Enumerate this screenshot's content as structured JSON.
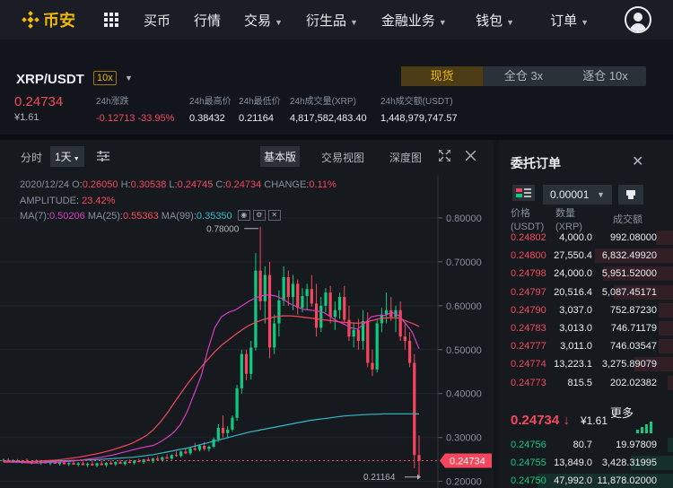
{
  "brand": {
    "name": "币安",
    "color": "#f0b90b"
  },
  "nav": {
    "items": [
      {
        "label": "买币",
        "has_dropdown": false
      },
      {
        "label": "行情",
        "has_dropdown": false
      },
      {
        "label": "交易",
        "has_dropdown": true
      },
      {
        "label": "衍生品",
        "has_dropdown": true
      },
      {
        "label": "金融业务",
        "has_dropdown": true
      }
    ],
    "right": [
      {
        "label": "钱包",
        "has_dropdown": true
      },
      {
        "label": "订单",
        "has_dropdown": true
      }
    ]
  },
  "ticker": {
    "pair": "XRP/USDT",
    "leverage": "10x",
    "last_price": "0.24734",
    "last_price_cny": "¥1.61",
    "stats": [
      {
        "label": "24h涨跌",
        "value": "-0.12713 -33.95%",
        "negative": true
      },
      {
        "label": "24h最高价",
        "value": "0.38432",
        "negative": false
      },
      {
        "label": "24h最低价",
        "value": "0.21164",
        "negative": false
      },
      {
        "label": "24h成交量(XRP)",
        "value": "4,817,582,483.40",
        "negative": false
      },
      {
        "label": "24h成交额(USDT)",
        "value": "1,448,979,747.57",
        "negative": false
      }
    ],
    "modes": [
      {
        "label": "现货",
        "active": true
      },
      {
        "label": "全仓 3x",
        "active": false
      },
      {
        "label": "逐仓 10x",
        "active": false
      }
    ]
  },
  "chart_toolbar": {
    "time_label": "分时",
    "interval": "1天",
    "views": [
      "基本版",
      "交易视图",
      "深度图"
    ],
    "active_view": "基本版"
  },
  "chart_info": {
    "date": "2020/12/24",
    "open_label": "O:",
    "open": "0.26050",
    "high_label": "H:",
    "high": "0.30538",
    "low_label": "L:",
    "low": "0.24745",
    "close_label": "C:",
    "close": "0.24734",
    "change_label": "CHANGE:",
    "change": "0.11%",
    "amplitude_label": "AMPLITUDE:",
    "amplitude": "23.42%",
    "ma7_label": "MA(7):",
    "ma7": "0.50206",
    "ma25_label": "MA(25):",
    "ma25": "0.55363",
    "ma99_label": "MA(99):",
    "ma99": "0.35350"
  },
  "chart_data": {
    "type": "candlestick",
    "y_ticks": [
      "0.80000",
      "0.70000",
      "0.60000",
      "0.50000",
      "0.40000",
      "0.30000",
      "0.20000"
    ],
    "ylim": [
      0.185,
      0.855
    ],
    "current_price_label": "0.24734",
    "annotations": {
      "high": "0.78000",
      "low": "0.21164"
    },
    "colors": {
      "up": "#0ecb81",
      "down": "#f6465d",
      "ma7": "#d63cc2",
      "ma25": "#f6465d",
      "ma99": "#31b9cc"
    },
    "candles": [
      [
        0.247,
        0.252,
        0.244,
        0.249
      ],
      [
        0.249,
        0.253,
        0.246,
        0.245
      ],
      [
        0.245,
        0.25,
        0.242,
        0.248
      ],
      [
        0.248,
        0.251,
        0.245,
        0.244
      ],
      [
        0.244,
        0.249,
        0.24,
        0.247
      ],
      [
        0.247,
        0.252,
        0.244,
        0.243
      ],
      [
        0.243,
        0.248,
        0.239,
        0.246
      ],
      [
        0.246,
        0.25,
        0.243,
        0.242
      ],
      [
        0.242,
        0.247,
        0.238,
        0.245
      ],
      [
        0.245,
        0.249,
        0.241,
        0.241
      ],
      [
        0.241,
        0.246,
        0.237,
        0.244
      ],
      [
        0.244,
        0.248,
        0.24,
        0.24
      ],
      [
        0.24,
        0.245,
        0.236,
        0.243
      ],
      [
        0.243,
        0.247,
        0.239,
        0.239
      ],
      [
        0.239,
        0.244,
        0.235,
        0.242
      ],
      [
        0.242,
        0.246,
        0.238,
        0.238
      ],
      [
        0.238,
        0.244,
        0.234,
        0.241
      ],
      [
        0.241,
        0.245,
        0.237,
        0.237
      ],
      [
        0.237,
        0.243,
        0.233,
        0.24
      ],
      [
        0.24,
        0.246,
        0.236,
        0.236
      ],
      [
        0.236,
        0.243,
        0.232,
        0.241
      ],
      [
        0.241,
        0.247,
        0.237,
        0.237
      ],
      [
        0.237,
        0.244,
        0.233,
        0.242
      ],
      [
        0.242,
        0.248,
        0.238,
        0.239
      ],
      [
        0.239,
        0.246,
        0.235,
        0.244
      ],
      [
        0.244,
        0.249,
        0.24,
        0.24
      ],
      [
        0.24,
        0.247,
        0.236,
        0.245
      ],
      [
        0.245,
        0.25,
        0.241,
        0.242
      ],
      [
        0.242,
        0.249,
        0.238,
        0.247
      ],
      [
        0.247,
        0.252,
        0.243,
        0.244
      ],
      [
        0.244,
        0.251,
        0.24,
        0.25
      ],
      [
        0.25,
        0.255,
        0.246,
        0.246
      ],
      [
        0.246,
        0.254,
        0.242,
        0.252
      ],
      [
        0.252,
        0.258,
        0.248,
        0.249
      ],
      [
        0.249,
        0.257,
        0.245,
        0.255
      ],
      [
        0.255,
        0.262,
        0.251,
        0.252
      ],
      [
        0.252,
        0.262,
        0.249,
        0.26
      ],
      [
        0.26,
        0.268,
        0.256,
        0.258
      ],
      [
        0.258,
        0.27,
        0.255,
        0.268
      ],
      [
        0.268,
        0.274,
        0.262,
        0.264
      ],
      [
        0.264,
        0.278,
        0.26,
        0.275
      ],
      [
        0.275,
        0.288,
        0.27,
        0.272
      ],
      [
        0.272,
        0.283,
        0.268,
        0.281
      ],
      [
        0.281,
        0.29,
        0.27,
        0.274
      ],
      [
        0.274,
        0.282,
        0.268,
        0.279
      ],
      [
        0.279,
        0.3,
        0.276,
        0.296
      ],
      [
        0.296,
        0.33,
        0.29,
        0.322
      ],
      [
        0.322,
        0.35,
        0.3,
        0.31
      ],
      [
        0.31,
        0.326,
        0.298,
        0.318
      ],
      [
        0.318,
        0.35,
        0.314,
        0.345
      ],
      [
        0.345,
        0.42,
        0.338,
        0.412
      ],
      [
        0.412,
        0.5,
        0.4,
        0.49
      ],
      [
        0.49,
        0.5,
        0.43,
        0.445
      ],
      [
        0.445,
        0.52,
        0.432,
        0.505
      ],
      [
        0.505,
        0.72,
        0.498,
        0.68
      ],
      [
        0.68,
        0.78,
        0.59,
        0.61
      ],
      [
        0.61,
        0.69,
        0.56,
        0.67
      ],
      [
        0.67,
        0.7,
        0.48,
        0.505
      ],
      [
        0.505,
        0.58,
        0.49,
        0.56
      ],
      [
        0.56,
        0.635,
        0.53,
        0.612
      ],
      [
        0.612,
        0.69,
        0.6,
        0.665
      ],
      [
        0.665,
        0.68,
        0.6,
        0.62
      ],
      [
        0.62,
        0.67,
        0.59,
        0.65
      ],
      [
        0.65,
        0.66,
        0.58,
        0.595
      ],
      [
        0.595,
        0.64,
        0.585,
        0.622
      ],
      [
        0.622,
        0.65,
        0.59,
        0.638
      ],
      [
        0.638,
        0.67,
        0.598,
        0.605
      ],
      [
        0.605,
        0.65,
        0.53,
        0.55
      ],
      [
        0.55,
        0.62,
        0.54,
        0.6
      ],
      [
        0.6,
        0.64,
        0.585,
        0.63
      ],
      [
        0.63,
        0.645,
        0.56,
        0.575
      ],
      [
        0.575,
        0.61,
        0.545,
        0.59
      ],
      [
        0.59,
        0.63,
        0.57,
        0.62
      ],
      [
        0.62,
        0.645,
        0.56,
        0.568
      ],
      [
        0.568,
        0.6,
        0.52,
        0.53
      ],
      [
        0.53,
        0.56,
        0.505,
        0.545
      ],
      [
        0.545,
        0.57,
        0.5,
        0.52
      ],
      [
        0.52,
        0.59,
        0.5,
        0.565
      ],
      [
        0.565,
        0.585,
        0.46,
        0.47
      ],
      [
        0.47,
        0.5,
        0.44,
        0.455
      ],
      [
        0.455,
        0.57,
        0.448,
        0.56
      ],
      [
        0.56,
        0.595,
        0.54,
        0.58
      ],
      [
        0.58,
        0.63,
        0.56,
        0.59
      ],
      [
        0.59,
        0.62,
        0.565,
        0.575
      ],
      [
        0.575,
        0.6,
        0.54,
        0.59
      ],
      [
        0.59,
        0.61,
        0.52,
        0.53
      ],
      [
        0.53,
        0.56,
        0.5,
        0.52
      ],
      [
        0.52,
        0.54,
        0.46,
        0.47
      ],
      [
        0.47,
        0.49,
        0.23,
        0.26
      ],
      [
        0.26,
        0.305,
        0.212,
        0.247
      ]
    ],
    "ma7": [
      0.246,
      0.245,
      0.244,
      0.243,
      0.242,
      0.242,
      0.243,
      0.244,
      0.244,
      0.245,
      0.246,
      0.248,
      0.25,
      0.252,
      0.254,
      0.257,
      0.26,
      0.264,
      0.268,
      0.272,
      0.276,
      0.279,
      0.282,
      0.29,
      0.3,
      0.312,
      0.33,
      0.36,
      0.4,
      0.44,
      0.5,
      0.55,
      0.575,
      0.585,
      0.59,
      0.6,
      0.61,
      0.618,
      0.623,
      0.625,
      0.622,
      0.615,
      0.605,
      0.598,
      0.592,
      0.59,
      0.588,
      0.585,
      0.575,
      0.565,
      0.558,
      0.55,
      0.547,
      0.56,
      0.575,
      0.578,
      0.578,
      0.585,
      0.578,
      0.56,
      0.54,
      0.502
    ],
    "ma25": [
      0.244,
      0.244,
      0.244,
      0.245,
      0.245,
      0.246,
      0.247,
      0.248,
      0.249,
      0.251,
      0.253,
      0.255,
      0.258,
      0.261,
      0.264,
      0.268,
      0.272,
      0.277,
      0.282,
      0.288,
      0.296,
      0.305,
      0.318,
      0.335,
      0.355,
      0.378,
      0.4,
      0.422,
      0.442,
      0.46,
      0.478,
      0.495,
      0.51,
      0.522,
      0.534,
      0.545,
      0.555,
      0.562,
      0.568,
      0.572,
      0.575,
      0.577,
      0.577,
      0.576,
      0.574,
      0.572,
      0.57,
      0.568,
      0.566,
      0.564,
      0.562,
      0.561,
      0.56,
      0.562,
      0.566,
      0.57,
      0.572,
      0.573,
      0.572,
      0.566,
      0.56,
      0.553
    ],
    "ma99": [
      0.245,
      0.245,
      0.245,
      0.245,
      0.245,
      0.246,
      0.246,
      0.246,
      0.247,
      0.247,
      0.248,
      0.248,
      0.249,
      0.249,
      0.25,
      0.251,
      0.252,
      0.253,
      0.254,
      0.255,
      0.257,
      0.259,
      0.261,
      0.264,
      0.267,
      0.27,
      0.273,
      0.276,
      0.28,
      0.284,
      0.288,
      0.292,
      0.296,
      0.3,
      0.304,
      0.308,
      0.312,
      0.315,
      0.318,
      0.321,
      0.324,
      0.327,
      0.33,
      0.333,
      0.336,
      0.339,
      0.341,
      0.343,
      0.345,
      0.347,
      0.349,
      0.35,
      0.351,
      0.352,
      0.353,
      0.353,
      0.354,
      0.354,
      0.354,
      0.354,
      0.354,
      0.3535
    ]
  },
  "order_book": {
    "title": "委托订单",
    "precision": "0.00001",
    "headers": [
      {
        "line1": "价格",
        "line2": "(USDT)"
      },
      {
        "line1": "数量",
        "line2": "(XRP)"
      },
      {
        "line1": "成交额",
        "line2": ""
      }
    ],
    "asks": [
      {
        "price": "0.24802",
        "amount": "4,000.0",
        "total": "992.08000",
        "depth": 0.1
      },
      {
        "price": "0.24800",
        "amount": "27,550.4",
        "total": "6,832.49920",
        "depth": 0.45
      },
      {
        "price": "0.24798",
        "amount": "24,000.0",
        "total": "5,951.52000",
        "depth": 0.4
      },
      {
        "price": "0.24797",
        "amount": "20,516.4",
        "total": "5,087.45171",
        "depth": 0.34
      },
      {
        "price": "0.24790",
        "amount": "3,037.0",
        "total": "752.87230",
        "depth": 0.08
      },
      {
        "price": "0.24783",
        "amount": "3,013.0",
        "total": "746.71179",
        "depth": 0.08
      },
      {
        "price": "0.24777",
        "amount": "3,011.0",
        "total": "746.03547",
        "depth": 0.08
      },
      {
        "price": "0.24774",
        "amount": "13,223.1",
        "total": "3,275.89079",
        "depth": 0.22
      },
      {
        "price": "0.24773",
        "amount": "815.5",
        "total": "202.02382",
        "depth": 0.03
      }
    ],
    "mid": {
      "price": "0.24734",
      "arrow": "↓",
      "cny": "¥1.61",
      "more": "更多"
    },
    "bids": [
      {
        "price": "0.24756",
        "amount": "80.7",
        "total": "19.97809",
        "depth": 0.03
      },
      {
        "price": "0.24755",
        "amount": "13,849.0",
        "total": "3,428.31995",
        "depth": 0.24
      },
      {
        "price": "0.24750",
        "amount": "47,992.0",
        "total": "11,878.02000",
        "depth": 0.78
      }
    ]
  }
}
